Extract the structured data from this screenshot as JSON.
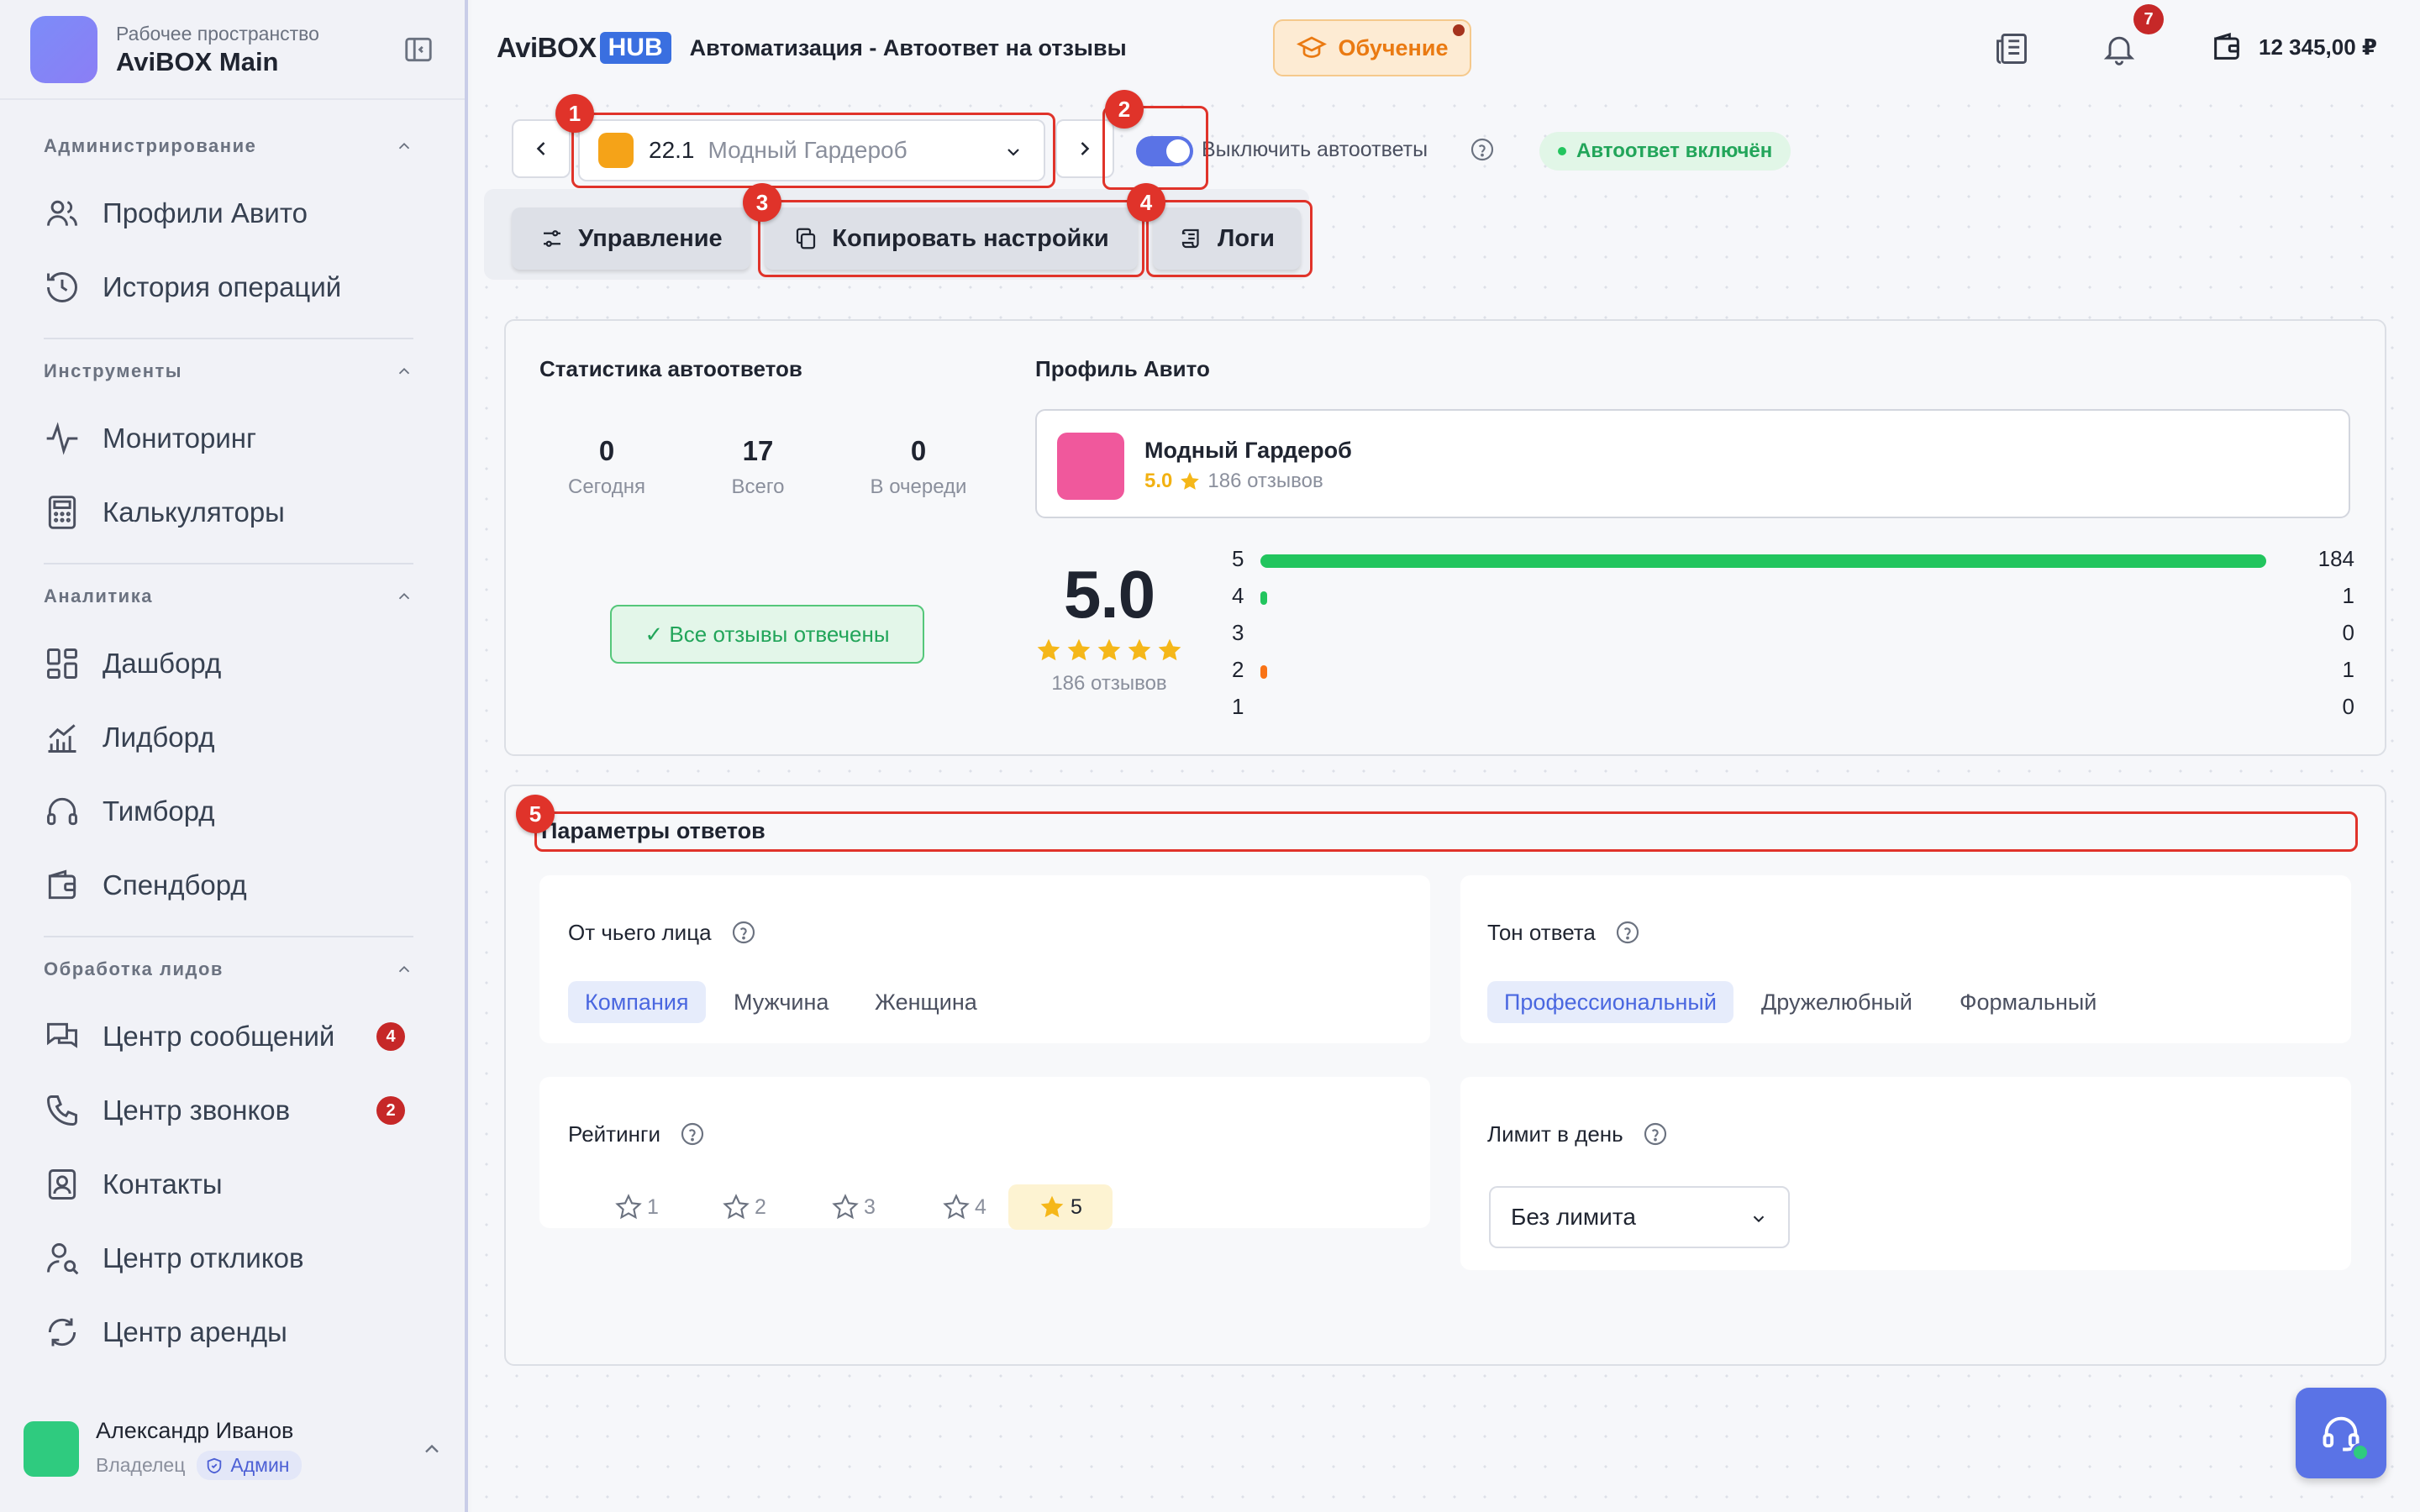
{
  "sidebar": {
    "workspace_sub": "Рабочее пространство",
    "workspace_name": "AviBOX Main",
    "sections": [
      {
        "title": "Администрирование",
        "items": [
          {
            "label": "Профили Авито",
            "icon": "users-icon"
          },
          {
            "label": "История операций",
            "icon": "history-icon"
          }
        ]
      },
      {
        "title": "Инструменты",
        "items": [
          {
            "label": "Мониторинг",
            "icon": "activity-icon"
          },
          {
            "label": "Калькуляторы",
            "icon": "calculator-icon"
          }
        ]
      },
      {
        "title": "Аналитика",
        "items": [
          {
            "label": "Дашборд",
            "icon": "dashboard-icon"
          },
          {
            "label": "Лидборд",
            "icon": "chart-icon"
          },
          {
            "label": "Тимборд",
            "icon": "headphones-icon"
          },
          {
            "label": "Спендборд",
            "icon": "wallet-icon"
          }
        ]
      },
      {
        "title": "Обработка лидов",
        "items": [
          {
            "label": "Центр сообщений",
            "icon": "messages-icon",
            "badge": "4"
          },
          {
            "label": "Центр звонков",
            "icon": "phone-icon",
            "badge": "2"
          },
          {
            "label": "Контакты",
            "icon": "contacts-icon"
          },
          {
            "label": "Центр откликов",
            "icon": "user-search-icon"
          },
          {
            "label": "Центр аренды",
            "icon": "refresh-icon"
          }
        ]
      }
    ],
    "user": {
      "name": "Александр Иванов",
      "role": "Владелец",
      "admin_label": "Админ"
    }
  },
  "header": {
    "brand_main": "AviBOX",
    "brand_hub": "HUB",
    "breadcrumb": "Автоматизация - Автоответ на отзывы",
    "learn_label": "Обучение",
    "notifications_count": "7",
    "balance": "12 345,00 ₽"
  },
  "controls": {
    "profile_id": "22.1",
    "profile_name": "Модный Гардероб",
    "toggle_label": "Выключить автоответы",
    "toggle_on": true,
    "status": "Автоответ включён",
    "tabs": [
      "Управление",
      "Копировать настройки",
      "Логи"
    ]
  },
  "markers": [
    "1",
    "2",
    "3",
    "4",
    "5"
  ],
  "stats": {
    "title": "Статистика автоответов",
    "items": [
      {
        "value": "0",
        "label": "Сегодня"
      },
      {
        "value": "17",
        "label": "Всего"
      },
      {
        "value": "0",
        "label": "В очереди"
      }
    ],
    "all_done": "✓ Все отзывы отвечены"
  },
  "profile": {
    "title": "Профиль Авито",
    "name": "Модный Гардероб",
    "rating": "5.0",
    "reviews": "186 отзывов",
    "big_rating": "5.0",
    "big_reviews": "186 отзывов",
    "distribution": [
      {
        "stars": "5",
        "count": "184",
        "share": 0.989,
        "color": "#22c55e"
      },
      {
        "stars": "4",
        "count": "1",
        "share": 0.005,
        "color": "#22c55e"
      },
      {
        "stars": "3",
        "count": "0",
        "share": 0,
        "color": "#22c55e"
      },
      {
        "stars": "2",
        "count": "1",
        "share": 0.005,
        "color": "#f97316"
      },
      {
        "stars": "1",
        "count": "0",
        "share": 0,
        "color": "#22c55e"
      }
    ]
  },
  "params": {
    "title": "Параметры ответов",
    "from_title": "От чьего лица",
    "from_options": [
      "Компания",
      "Мужчина",
      "Женщина"
    ],
    "from_selected": "Компания",
    "tone_title": "Тон ответа",
    "tone_options": [
      "Профессиональный",
      "Дружелюбный",
      "Формальный"
    ],
    "tone_selected": "Профессиональный",
    "ratings_title": "Рейтинги",
    "ratings_options": [
      "1",
      "2",
      "3",
      "4",
      "5"
    ],
    "ratings_selected": "5",
    "limit_title": "Лимит в день",
    "limit_value": "Без лимита"
  }
}
